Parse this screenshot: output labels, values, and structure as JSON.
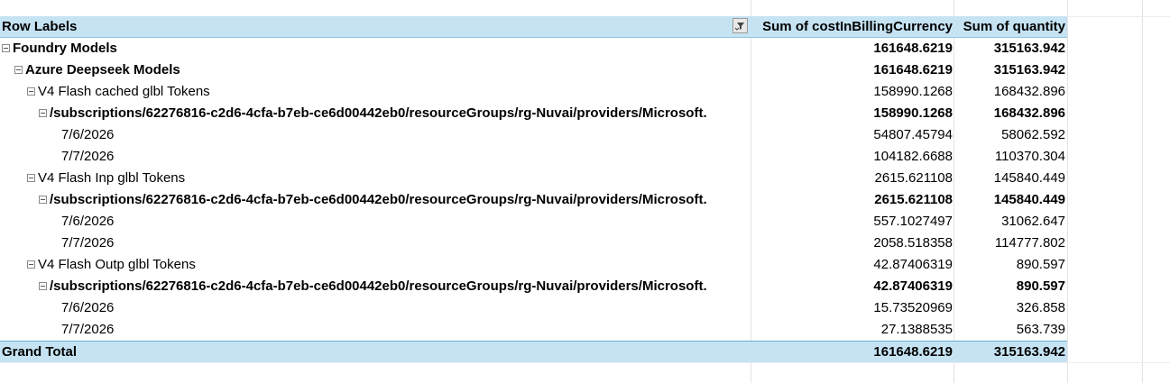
{
  "pivot": {
    "header": {
      "row_labels": "Row Labels",
      "col1": "Sum of costInBillingCurrency",
      "col2": "Sum of quantity",
      "filter_icon": "filter-dropdown-icon"
    },
    "rows": [
      {
        "label": "Foundry Models",
        "cost": "161648.6219",
        "qty": "315163.942",
        "bold": true,
        "toggle": true,
        "level": 0
      },
      {
        "label": "Azure Deepseek Models",
        "cost": "161648.6219",
        "qty": "315163.942",
        "bold": true,
        "toggle": true,
        "level": 1
      },
      {
        "label": "V4 Flash cached glbl Tokens",
        "cost": "158990.1268",
        "qty": "168432.896",
        "bold": false,
        "toggle": true,
        "level": 2
      },
      {
        "label": "/subscriptions/62276816-c2d6-4cfa-b7eb-ce6d00442eb0/resourceGroups/rg-Nuvai/providers/Microsoft.",
        "cost": "158990.1268",
        "qty": "168432.896",
        "bold": true,
        "toggle": true,
        "level": 3
      },
      {
        "label": "7/6/2026",
        "cost": "54807.45794",
        "qty": "58062.592",
        "bold": false,
        "toggle": false,
        "level": 4
      },
      {
        "label": "7/7/2026",
        "cost": "104182.6688",
        "qty": "110370.304",
        "bold": false,
        "toggle": false,
        "level": 4
      },
      {
        "label": "V4 Flash Inp glbl Tokens",
        "cost": "2615.621108",
        "qty": "145840.449",
        "bold": false,
        "toggle": true,
        "level": 2
      },
      {
        "label": "/subscriptions/62276816-c2d6-4cfa-b7eb-ce6d00442eb0/resourceGroups/rg-Nuvai/providers/Microsoft.",
        "cost": "2615.621108",
        "qty": "145840.449",
        "bold": true,
        "toggle": true,
        "level": 3
      },
      {
        "label": "7/6/2026",
        "cost": "557.1027497",
        "qty": "31062.647",
        "bold": false,
        "toggle": false,
        "level": 4
      },
      {
        "label": "7/7/2026",
        "cost": "2058.518358",
        "qty": "114777.802",
        "bold": false,
        "toggle": false,
        "level": 4
      },
      {
        "label": "V4 Flash Outp glbl Tokens",
        "cost": "42.87406319",
        "qty": "890.597",
        "bold": false,
        "toggle": true,
        "level": 2
      },
      {
        "label": "/subscriptions/62276816-c2d6-4cfa-b7eb-ce6d00442eb0/resourceGroups/rg-Nuvai/providers/Microsoft.",
        "cost": "42.87406319",
        "qty": "890.597",
        "bold": true,
        "toggle": true,
        "level": 3
      },
      {
        "label": "7/6/2026",
        "cost": "15.73520969",
        "qty": "326.858",
        "bold": false,
        "toggle": false,
        "level": 4
      },
      {
        "label": "7/7/2026",
        "cost": "27.1388535",
        "qty": "563.739",
        "bold": false,
        "toggle": false,
        "level": 4
      }
    ],
    "grand_total": {
      "label": "Grand Total",
      "cost": "161648.6219",
      "qty": "315163.942"
    },
    "colors": {
      "header_bg": "#c6e3f3",
      "total_border": "#6ab0d6"
    }
  }
}
